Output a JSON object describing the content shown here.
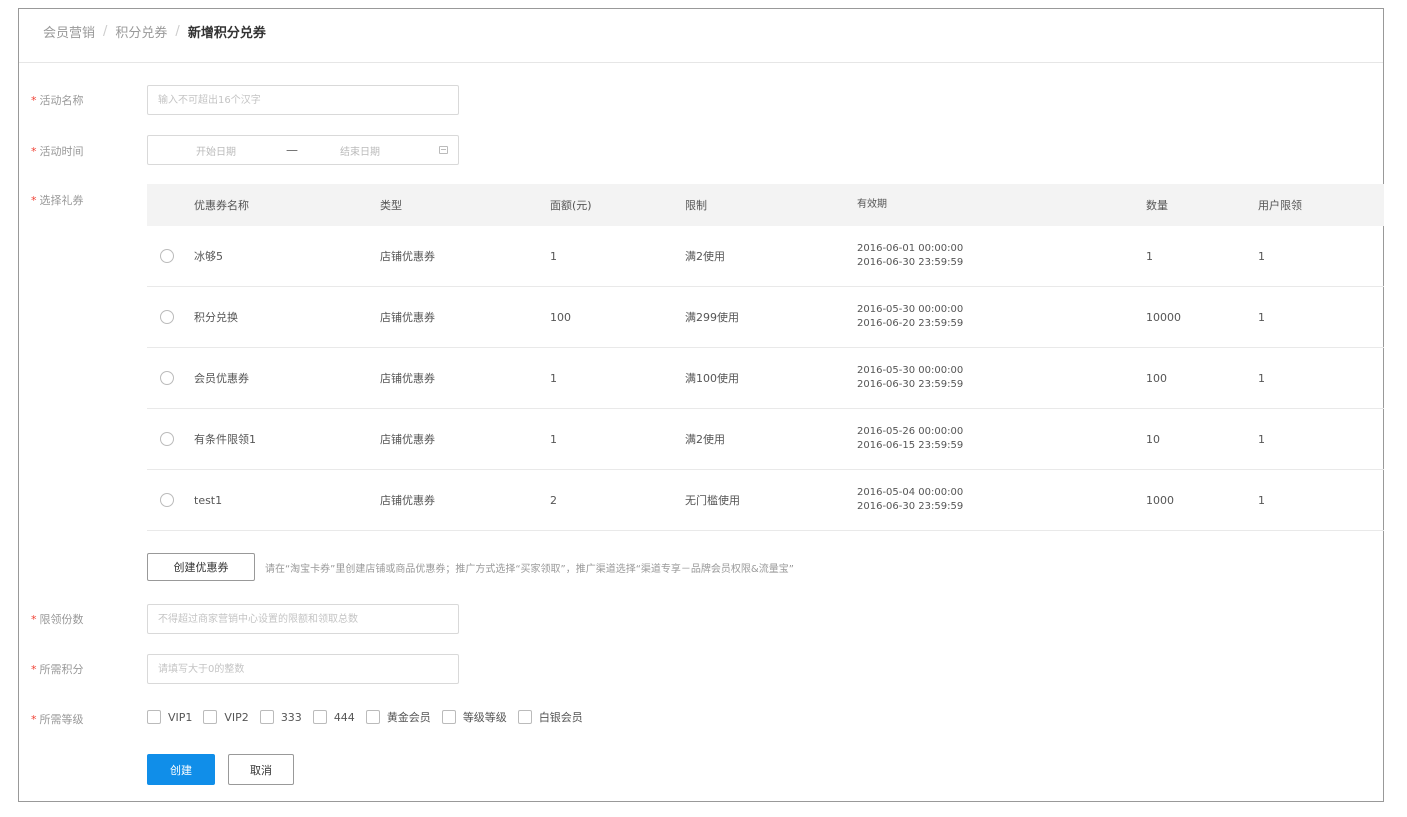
{
  "breadcrumb": {
    "items": [
      "会员营销",
      "积分兑券"
    ],
    "separator": "/",
    "current": "新增积分兑券"
  },
  "form": {
    "required_mark": "*",
    "activity_name": {
      "label": "活动名称",
      "placeholder": "输入不可超出16个汉字"
    },
    "activity_time": {
      "label": "活动时间",
      "start_placeholder": "开始日期",
      "separator": "—",
      "end_placeholder": "结束日期"
    },
    "select_coupon": {
      "label": "选择礼券"
    },
    "limit_count": {
      "label": "限领份数",
      "placeholder": "不得超过商家营销中心设置的限额和领取总数"
    },
    "points_required": {
      "label": "所需积分",
      "placeholder": "请填写大于0的整数"
    },
    "level_required": {
      "label": "所需等级",
      "options": [
        "VIP1",
        "VIP2",
        "333",
        "444",
        "黄金会员",
        "等级等级",
        "白银会员"
      ]
    }
  },
  "table": {
    "columns": [
      "优惠券名称",
      "类型",
      "面额(元)",
      "限制",
      "有效期",
      "数量",
      "用户限领"
    ],
    "rows": [
      {
        "name": "冰够5",
        "type": "店铺优惠券",
        "amount": "1",
        "limit": "满2使用",
        "valid_from": "2016-06-01 00:00:00",
        "valid_to": "2016-06-30 23:59:59",
        "qty": "1",
        "user_limit": "1"
      },
      {
        "name": "积分兑换",
        "type": "店铺优惠券",
        "amount": "100",
        "limit": "满299使用",
        "valid_from": "2016-05-30 00:00:00",
        "valid_to": "2016-06-20 23:59:59",
        "qty": "10000",
        "user_limit": "1"
      },
      {
        "name": "会员优惠券",
        "type": "店铺优惠券",
        "amount": "1",
        "limit": "满100使用",
        "valid_from": "2016-05-30 00:00:00",
        "valid_to": "2016-06-30 23:59:59",
        "qty": "100",
        "user_limit": "1"
      },
      {
        "name": "有条件限领1",
        "type": "店铺优惠券",
        "amount": "1",
        "limit": "满2使用",
        "valid_from": "2016-05-26 00:00:00",
        "valid_to": "2016-06-15 23:59:59",
        "qty": "10",
        "user_limit": "1"
      },
      {
        "name": "test1",
        "type": "店铺优惠券",
        "amount": "2",
        "limit": "无门槛使用",
        "valid_from": "2016-05-04 00:00:00",
        "valid_to": "2016-06-30 23:59:59",
        "qty": "1000",
        "user_limit": "1"
      }
    ]
  },
  "create_coupon": {
    "button_label": "创建优惠券",
    "hint": "请在“淘宝卡券”里创建店铺或商品优惠券；推广方式选择“买家领取”，推广渠道选择“渠道专享－品牌会员权限&流量宝”"
  },
  "actions": {
    "submit_label": "创建",
    "cancel_label": "取消"
  },
  "colors": {
    "primary": "#108ee9",
    "required_star": "#f04134",
    "table_header_bg": "#f3f3f3"
  },
  "icons": {
    "date_picker": "calendar-icon"
  }
}
